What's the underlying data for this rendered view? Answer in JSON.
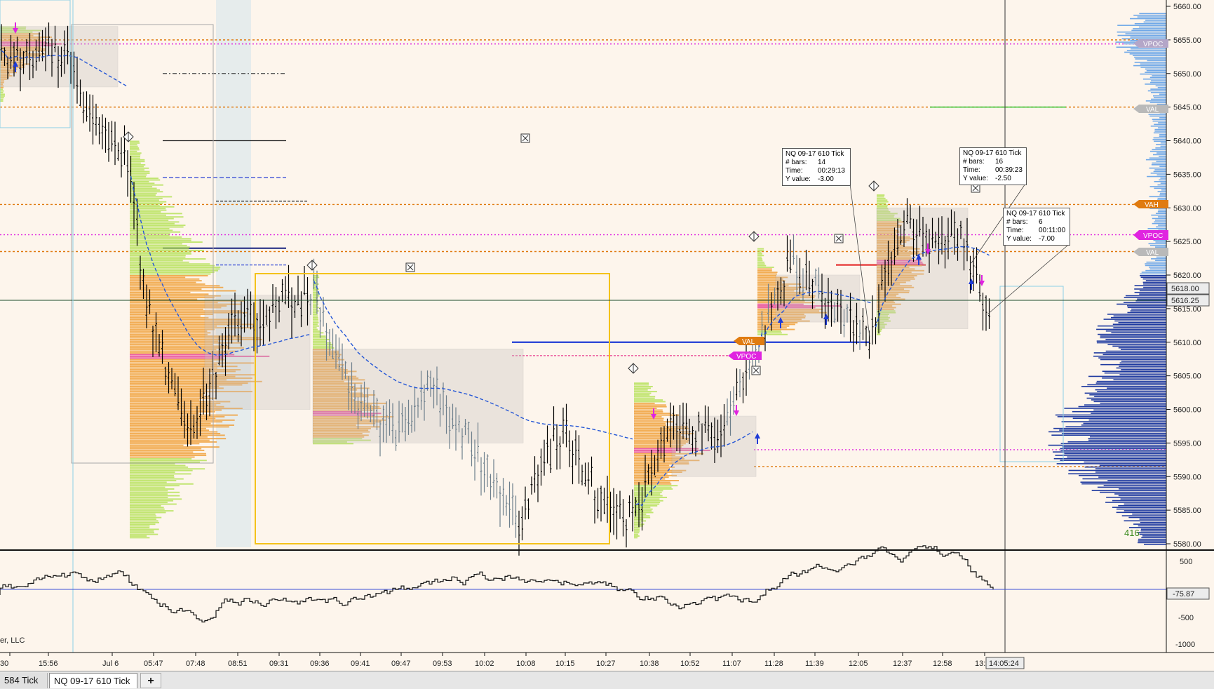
{
  "price_axis": {
    "labels": [
      "5660.00",
      "5655.00",
      "5650.00",
      "5645.00",
      "5640.00",
      "5635.00",
      "5630.00",
      "5625.00",
      "5620.00",
      "5615.00",
      "5610.00",
      "5605.00",
      "5600.00",
      "5595.00",
      "5590.00",
      "5585.00",
      "5580.00"
    ],
    "current_price": "5616.25",
    "crosshair_price": "5618.00",
    "volume_count": "416"
  },
  "indicator_axis": {
    "labels": [
      "500",
      "-500",
      "-1000"
    ],
    "current_value": "-75.87"
  },
  "time_axis": {
    "labels": [
      "30",
      "15:56",
      "Jul 6",
      "05:47",
      "07:48",
      "08:51",
      "09:31",
      "09:36",
      "09:41",
      "09:47",
      "09:53",
      "10:02",
      "10:08",
      "10:15",
      "10:27",
      "10:38",
      "10:52",
      "11:07",
      "11:28",
      "11:39",
      "12:05",
      "12:37",
      "12:58",
      "13:35"
    ],
    "crosshair_time": "14:05:24"
  },
  "profile_tags": {
    "vpoc": "VPOC",
    "val": "VAL",
    "vah": "VAH"
  },
  "tooltips": [
    {
      "title": "NQ 09-17 610 Tick",
      "bars_label": "# bars:",
      "bars": "14",
      "time_label": "Time:",
      "time": "00:29:13",
      "y_label": "Y value:",
      "y": "-3.00"
    },
    {
      "title": "NQ 09-17 610 Tick",
      "bars_label": "# bars:",
      "bars": "16",
      "time_label": "Time:",
      "time": "00:39:23",
      "y_label": "Y value:",
      "y": "-2.50"
    },
    {
      "title": "NQ 09-17 610 Tick",
      "bars_label": "# bars:",
      "bars": "6",
      "time_label": "Time:",
      "time": "00:11:00",
      "y_label": "Y value:",
      "y": "-7.00"
    }
  ],
  "copyright": "er, LLC",
  "tabs": {
    "inactive": "584 Tick",
    "active": "NQ 09-17 610 Tick",
    "add": "+"
  },
  "colors": {
    "background": "#fdf5ec",
    "candle": "#000000",
    "wick_grey": "#6d7f8c",
    "vwap": "#2456d6",
    "vpoc": "#e024e0",
    "value_area": "#e07b10",
    "profile_blue": "#1e3aa0",
    "profile_light": "#6fa8e8",
    "green_volume": "#7fd63a"
  }
}
